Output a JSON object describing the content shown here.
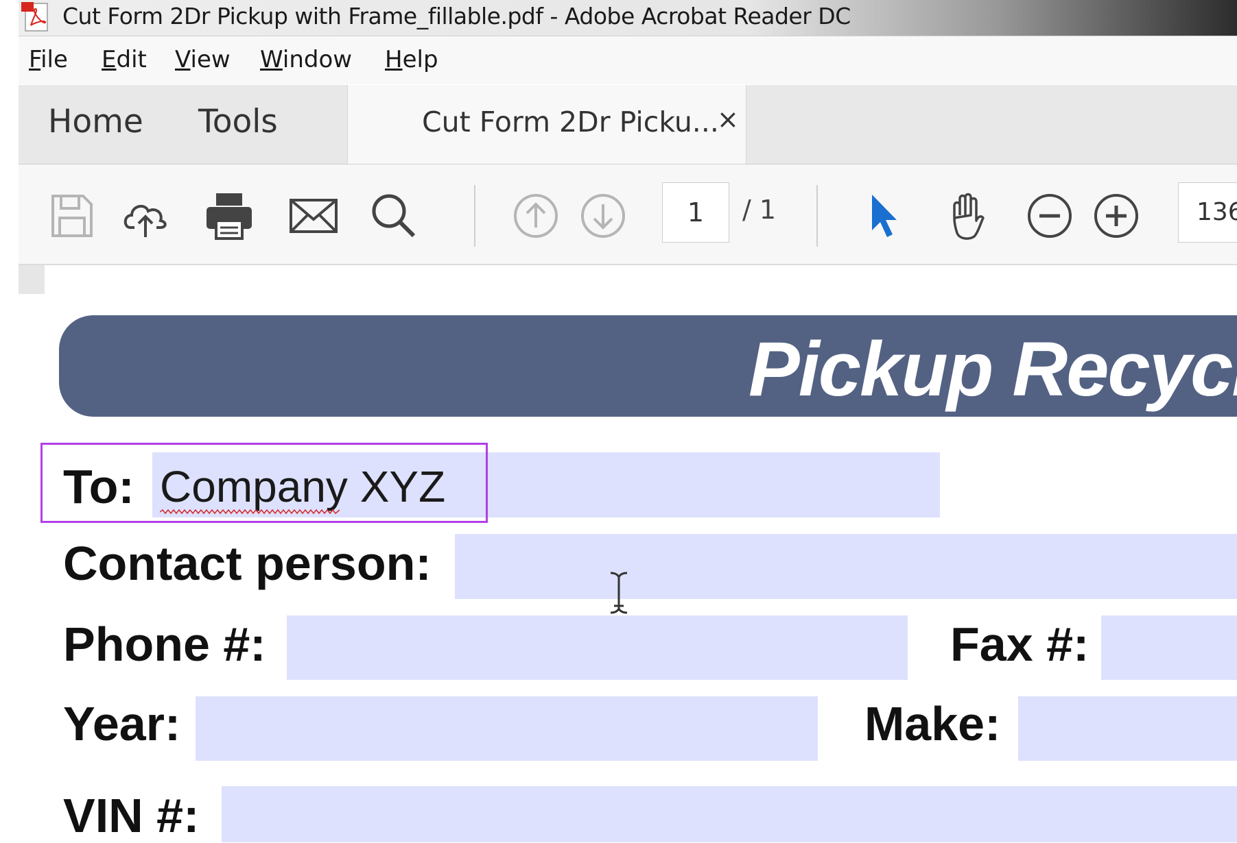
{
  "window": {
    "title": "Cut Form 2Dr Pickup with Frame_fillable.pdf - Adobe Acrobat Reader DC",
    "app_icon": "acrobat-pdf-icon"
  },
  "menubar": {
    "items": [
      {
        "mnemonic": "F",
        "rest": "ile"
      },
      {
        "mnemonic": "E",
        "rest": "dit"
      },
      {
        "mnemonic": "V",
        "rest": "iew"
      },
      {
        "mnemonic": "W",
        "rest": "indow"
      },
      {
        "mnemonic": "H",
        "rest": "elp"
      }
    ]
  },
  "tabs": {
    "home": "Home",
    "tools": "Tools",
    "document": "Cut Form 2Dr Picku...",
    "close": "×"
  },
  "toolbar": {
    "icons": [
      "save-icon",
      "cloud-upload-icon",
      "print-icon",
      "email-icon",
      "search-icon",
      "page-up-icon",
      "page-down-icon",
      "select-arrow-icon",
      "hand-icon",
      "zoom-out-icon",
      "zoom-in-icon"
    ],
    "page_current": "1",
    "page_total": "/ 1",
    "zoom": "136"
  },
  "document": {
    "banner_title": "Pickup Recycle",
    "fields": {
      "to": {
        "label": "To:",
        "value": "Company XYZ"
      },
      "contact": {
        "label": "Contact person:",
        "value": ""
      },
      "phone": {
        "label": "Phone #:",
        "value": ""
      },
      "fax": {
        "label": "Fax #:",
        "value": ""
      },
      "year": {
        "label": "Year:",
        "value": ""
      },
      "make": {
        "label": "Make:",
        "value": ""
      },
      "vin": {
        "label": "VIN #:",
        "value": ""
      }
    }
  },
  "colors": {
    "banner": "#536283",
    "field_fill": "#dde1fd",
    "focus_border": "#b23fe8",
    "select_arrow": "#1a6fd0"
  }
}
